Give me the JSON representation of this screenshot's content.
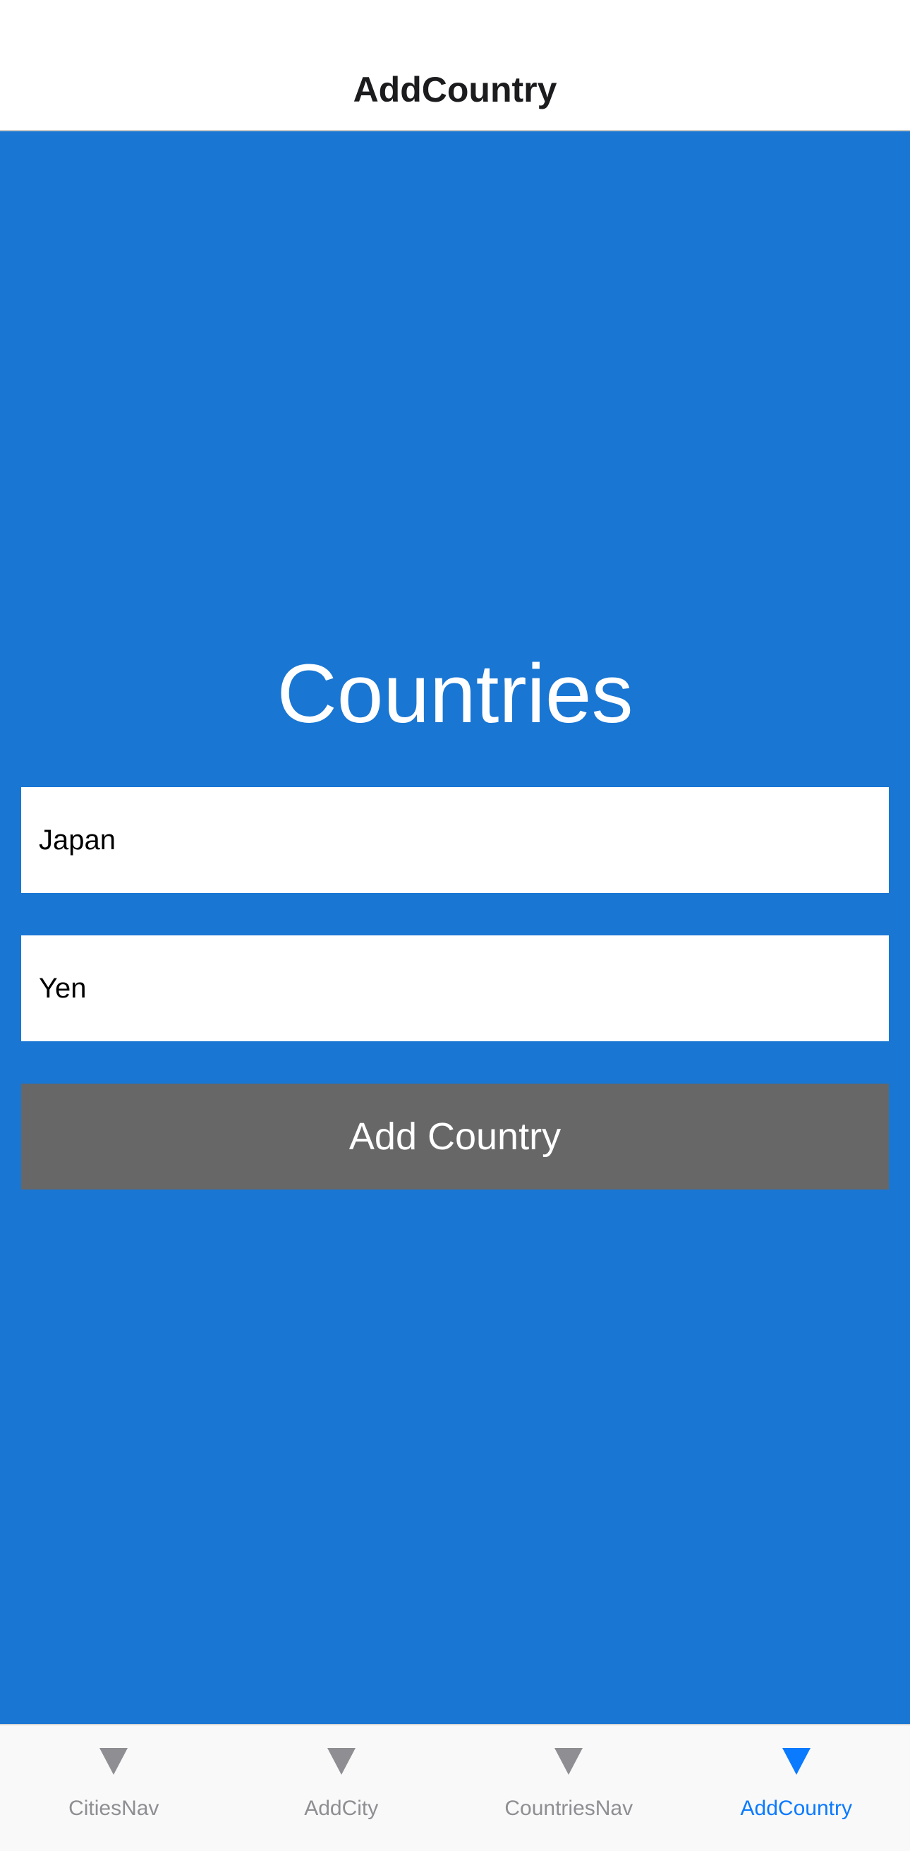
{
  "header": {
    "title": "AddCountry"
  },
  "main": {
    "heading": "Countries",
    "country_field": {
      "value": "Japan"
    },
    "currency_field": {
      "value": "Yen"
    },
    "add_button_label": "Add Country"
  },
  "tabbar": {
    "tabs": [
      {
        "label": "CitiesNav",
        "icon": "triangle-down-icon",
        "active": false
      },
      {
        "label": "AddCity",
        "icon": "triangle-down-icon",
        "active": false
      },
      {
        "label": "CountriesNav",
        "icon": "triangle-down-icon",
        "active": false
      },
      {
        "label": "AddCountry",
        "icon": "triangle-down-icon",
        "active": true
      }
    ]
  },
  "colors": {
    "content_background": "#1976d3",
    "button_background": "#676767",
    "tab_active": "#0a7aff",
    "tab_inactive": "#8e8e93"
  }
}
